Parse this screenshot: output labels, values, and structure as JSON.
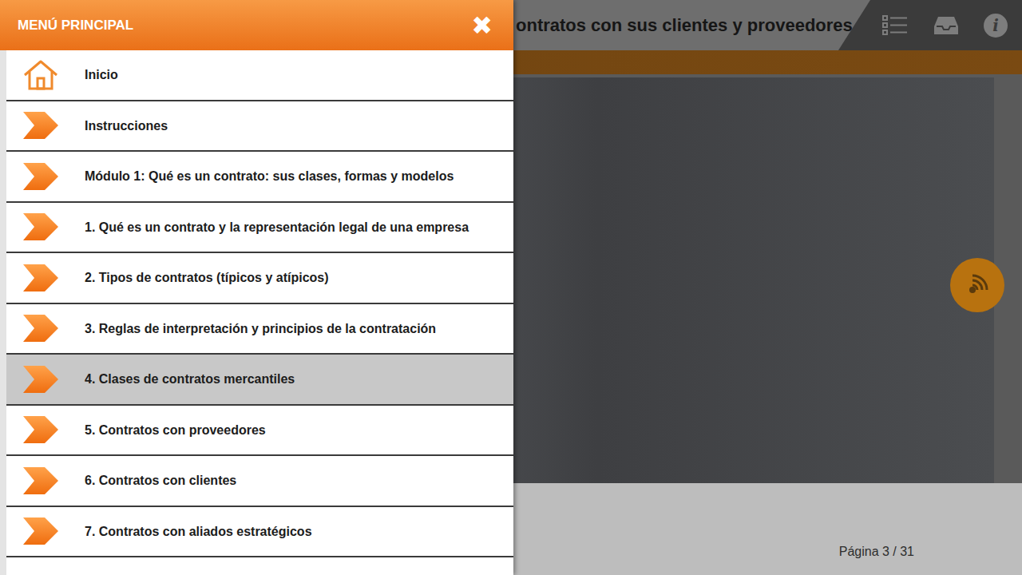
{
  "course_header": {
    "title": "ontratos con sus clientes y proveedores",
    "info_glyph": "i"
  },
  "menu": {
    "title": "MENÚ PRINCIPAL",
    "close": "✖",
    "items": [
      {
        "label": "Inicio",
        "kind": "home",
        "selected": false
      },
      {
        "label": "Instrucciones",
        "kind": "arrow",
        "selected": false
      },
      {
        "label": "Módulo 1: Qué es un contrato: sus clases, formas y modelos",
        "kind": "arrow",
        "selected": false
      },
      {
        "label": "1. Qué es un contrato y la representación legal de una empresa",
        "kind": "arrow",
        "selected": false
      },
      {
        "label": "2. Tipos de contratos (típicos y atípicos)",
        "kind": "arrow",
        "selected": false
      },
      {
        "label": "3. Reglas de interpretación y principios de la contratación",
        "kind": "arrow",
        "selected": false
      },
      {
        "label": "4. Clases de contratos mercantiles",
        "kind": "arrow",
        "selected": true
      },
      {
        "label": "5. Contratos con proveedores",
        "kind": "arrow",
        "selected": false
      },
      {
        "label": "6. Contratos con clientes",
        "kind": "arrow",
        "selected": false
      },
      {
        "label": "7. Contratos con aliados estratégicos",
        "kind": "arrow",
        "selected": false
      }
    ]
  },
  "footer": {
    "page": "Página 3 / 31"
  }
}
